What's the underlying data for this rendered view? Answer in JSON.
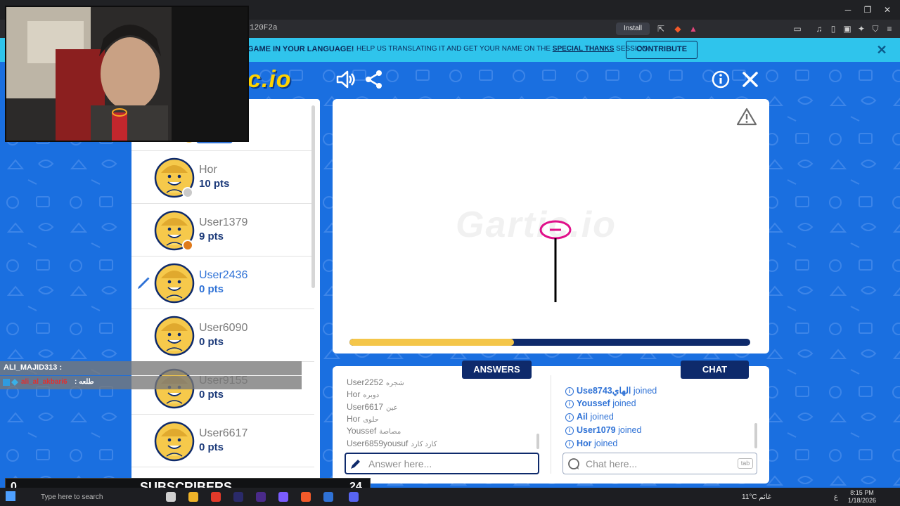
{
  "browser": {
    "url_fragment": "120F2a",
    "install_label": "Install"
  },
  "banner": {
    "title": "GAME IN YOUR LANGUAGE!",
    "help_prefix": "HELP US TRANSLATING IT AND GET YOUR NAME ON THE ",
    "help_link": "SPECIAL THANKS",
    "help_suffix": " SESSION",
    "contribute_label": "CONTRIBUTE",
    "close_icon": "close-icon"
  },
  "game": {
    "logo_text": "c.io",
    "watermark": "Gartic.io",
    "timer_fraction": 0.41
  },
  "players": [
    {
      "name": "Hor",
      "points": "10 pts",
      "active": false,
      "status_dot": "#c9c9c9"
    },
    {
      "name": "User1379",
      "points": "9 pts",
      "active": false,
      "status_dot": "#e07a1a"
    },
    {
      "name": "User2436",
      "points": "0 pts",
      "active": true,
      "status_dot": ""
    },
    {
      "name": "User6090",
      "points": "0 pts",
      "active": false,
      "status_dot": ""
    },
    {
      "name": "User9155",
      "points": "0 pts",
      "active": false,
      "status_dot": ""
    },
    {
      "name": "User6617",
      "points": "0 pts",
      "active": false,
      "status_dot": ""
    }
  ],
  "tabs": {
    "answers_label": "ANSWERS",
    "chat_label": "CHAT"
  },
  "answers": [
    {
      "user": "User2252",
      "guess": "شجره"
    },
    {
      "user": "Hor",
      "guess": "دوبره"
    },
    {
      "user": "User6617",
      "guess": "عين"
    },
    {
      "user": "Hor",
      "guess": "حلوى"
    },
    {
      "user": "Youssef",
      "guess": "مصاصة"
    },
    {
      "user": "User6859yousuf",
      "guess": "كارد كارد"
    }
  ],
  "chat": [
    {
      "user": "Useالهاي8743",
      "action": "joined"
    },
    {
      "user": "Youssef",
      "action": "joined"
    },
    {
      "user": "Ail",
      "action": "joined"
    },
    {
      "user": "User1079",
      "action": "joined"
    },
    {
      "user": "Hor",
      "action": "joined"
    }
  ],
  "inputs": {
    "answer_placeholder": "Answer here...",
    "chat_placeholder": "Chat here...",
    "tab_hint": "tab"
  },
  "stream": {
    "chat1": "ALI_MAJID313 :",
    "chat2_user": "ali_al_akbari6",
    "chat2_msg": ": طلعه",
    "subscribers_label": "SUBSCRIBERS",
    "sub_left": "0",
    "sub_right": "24"
  },
  "taskbar": {
    "search_placeholder": "Type here to search",
    "weather": "11°C  غائم",
    "lang": "ع",
    "time": "8:15 PM",
    "date": "1/18/2026"
  },
  "colors": {
    "page_blue": "#1a6fe0",
    "navy": "#0e2a6b",
    "banner": "#2fc4ec",
    "timer": "#f4c64a",
    "link_blue": "#2f72d6"
  }
}
